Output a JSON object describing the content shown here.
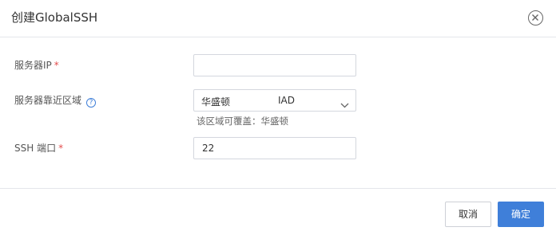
{
  "dialog": {
    "title": "创建GlobalSSH",
    "close_icon": "close-circle-icon"
  },
  "form": {
    "server_ip": {
      "label": "服务器IP",
      "required_mark": "*",
      "value": "",
      "placeholder": ""
    },
    "region": {
      "label": "服务器靠近区域",
      "help_icon": "question-circle-icon",
      "help_glyph": "?",
      "selected_name": "华盛顿",
      "selected_code": "IAD",
      "dropdown_icon": "chevron-down-icon",
      "hint": "该区域可覆盖：华盛顿"
    },
    "ssh_port": {
      "label": "SSH 端口",
      "required_mark": "*",
      "value": "22"
    }
  },
  "footer": {
    "cancel_label": "取消",
    "ok_label": "确定",
    "accent_color": "#3f7fd9"
  }
}
